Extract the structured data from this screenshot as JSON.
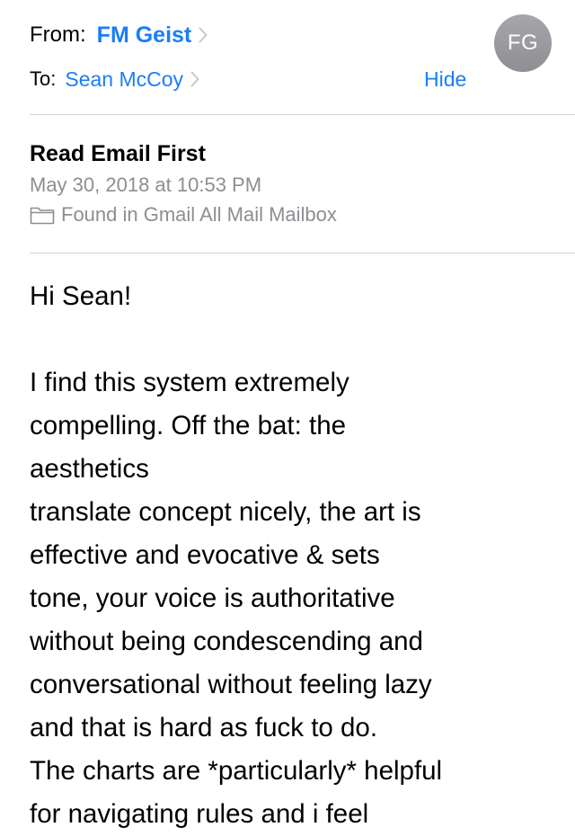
{
  "header": {
    "from_label": "From:",
    "sender_name": "FM Geist",
    "to_label": "To:",
    "recipient_name": "Sean McCoy",
    "hide_label": "Hide",
    "avatar_initials": "FG",
    "link_color": "#1a7ef7",
    "avatar_color": "#8e8e93"
  },
  "message": {
    "subject": "Read Email First",
    "date": "May 30, 2018 at 10:53 PM",
    "mailbox_text": "Found in Gmail All Mail Mailbox",
    "mailbox_icon": "folder-icon"
  },
  "body": {
    "greeting": "Hi Sean!",
    "lines": [
      "I find this system extremely",
      "compelling. Off the bat: the",
      "aesthetics",
      "translate concept nicely, the art is",
      "effective and evocative & sets",
      "tone, your voice is authoritative",
      "without being condescending and",
      "conversational without feeling lazy",
      "and that is hard as fuck to do.",
      "The charts are *particularly* helpful",
      "for navigating rules and i feel"
    ]
  }
}
